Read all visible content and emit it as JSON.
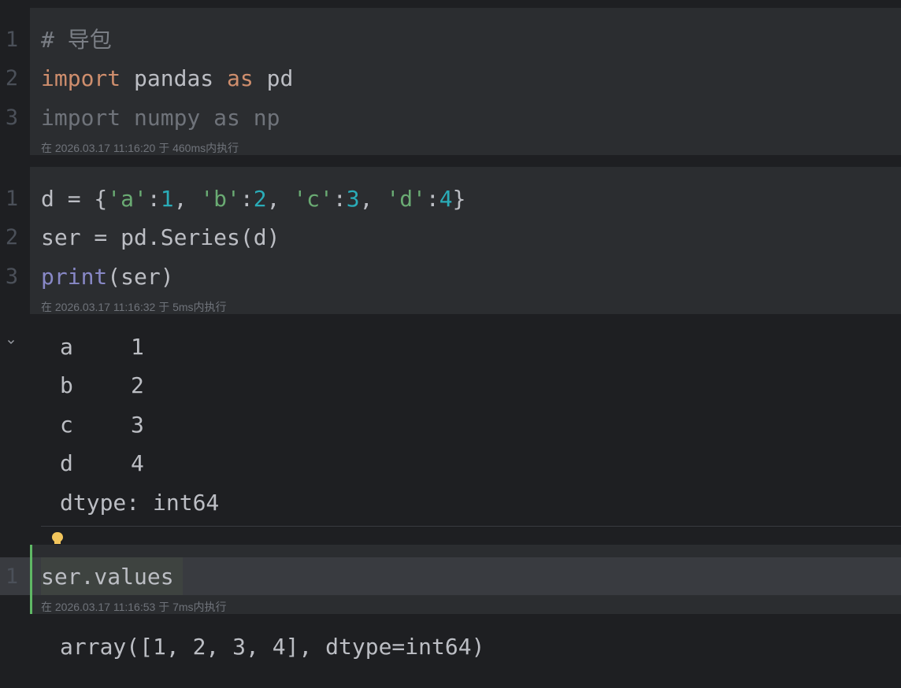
{
  "cells": [
    {
      "lines": [
        {
          "num": "1",
          "tokens": [
            {
              "t": "# 导包",
              "c": "comment"
            }
          ]
        },
        {
          "num": "2",
          "tokens": [
            {
              "t": "import",
              "c": "kw"
            },
            {
              "t": " pandas ",
              "c": ""
            },
            {
              "t": "as",
              "c": "kw"
            },
            {
              "t": " pd",
              "c": ""
            }
          ]
        },
        {
          "num": "3",
          "tokens": [
            {
              "t": "import numpy as np",
              "c": "dim"
            }
          ]
        }
      ],
      "meta": "在 2026.03.17 11:16:20 于 460ms内执行"
    },
    {
      "lines": [
        {
          "num": "1",
          "tokens": [
            {
              "t": "d = {",
              "c": ""
            },
            {
              "t": "'a'",
              "c": "str"
            },
            {
              "t": ":",
              "c": ""
            },
            {
              "t": "1",
              "c": "num"
            },
            {
              "t": ", ",
              "c": ""
            },
            {
              "t": "'b'",
              "c": "str"
            },
            {
              "t": ":",
              "c": ""
            },
            {
              "t": "2",
              "c": "num"
            },
            {
              "t": ", ",
              "c": ""
            },
            {
              "t": "'c'",
              "c": "str"
            },
            {
              "t": ":",
              "c": ""
            },
            {
              "t": "3",
              "c": "num"
            },
            {
              "t": ", ",
              "c": ""
            },
            {
              "t": "'d'",
              "c": "str"
            },
            {
              "t": ":",
              "c": ""
            },
            {
              "t": "4",
              "c": "num"
            },
            {
              "t": "}",
              "c": ""
            }
          ]
        },
        {
          "num": "2",
          "tokens": [
            {
              "t": "ser = pd.Series(d)",
              "c": ""
            }
          ]
        },
        {
          "num": "3",
          "tokens": [
            {
              "t": "print",
              "c": "builtin"
            },
            {
              "t": "(ser)",
              "c": ""
            }
          ]
        }
      ],
      "meta": "在 2026.03.17 11:16:32 于 5ms内执行",
      "output": {
        "rows": [
          {
            "index": "a",
            "value": "1"
          },
          {
            "index": "b",
            "value": "2"
          },
          {
            "index": "c",
            "value": "3"
          },
          {
            "index": "d",
            "value": "4"
          }
        ],
        "dtype": "dtype: int64"
      }
    },
    {
      "lines": [
        {
          "num": "1",
          "tokens": [
            {
              "t": "ser.values",
              "c": ""
            }
          ]
        }
      ],
      "meta": "在 2026.03.17 11:16:53 于 7ms内执行",
      "output_text": "array([1, 2, 3, 4], dtype=int64)"
    }
  ],
  "icons": {
    "collapse": "chevron-down-icon",
    "intention": "lightbulb-icon"
  },
  "colors": {
    "keyword": "#cf8e6d",
    "string": "#6aab73",
    "number": "#2aacb8",
    "builtin": "#8888c6",
    "active_bar": "#5fb865"
  }
}
